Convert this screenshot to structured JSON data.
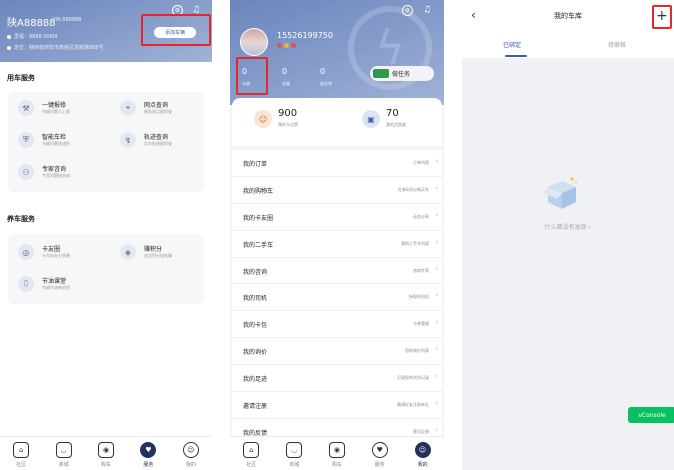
{
  "panel1": {
    "plate": "陕A88888",
    "vin": "VIN:888888",
    "mileage": "里程：8888.00KM",
    "location": "定位：陕西省西安市高新区高新路888号",
    "add_car_label": "添加车辆",
    "section_car": "用车服务",
    "car_services": [
      {
        "icon": "wrench-icon",
        "glyph": "⚒",
        "title": "一键报修",
        "sub": "车辆问题马上报"
      },
      {
        "icon": "location-icon",
        "glyph": "⌖",
        "title": "网点查询",
        "sub": "服务网点随时查"
      },
      {
        "icon": "shield-icon",
        "glyph": "⛨",
        "title": "智能车检",
        "sub": "车辆问题快速检"
      },
      {
        "icon": "speed-icon",
        "glyph": "↯",
        "title": "轨迹查询",
        "sub": "实车轨迹随时查"
      },
      {
        "icon": "expert-icon",
        "glyph": "⚇",
        "title": "专家咨询",
        "sub": "专家问题快咨询"
      }
    ],
    "section_maintain": "养车服务",
    "maintain_services": [
      {
        "icon": "friends-icon",
        "glyph": "◎",
        "title": "卡友圈",
        "sub": "卡车好友分享圈"
      },
      {
        "icon": "points-icon",
        "glyph": "◈",
        "title": "赚积分",
        "sub": "会员积分轻松赚"
      },
      {
        "icon": "drop-icon",
        "glyph": "⬯",
        "title": "节油课堂",
        "sub": "车辆节油有妙招"
      }
    ],
    "tabs": [
      {
        "icon": "home-icon",
        "glyph": "⌂",
        "label": "社区",
        "active": false
      },
      {
        "icon": "mall-icon",
        "glyph": "◡",
        "label": "商城",
        "active": false
      },
      {
        "icon": "car-icon",
        "glyph": "◉",
        "label": "购车",
        "active": false
      },
      {
        "icon": "service-icon",
        "glyph": "♥",
        "label": "服务",
        "active": true
      },
      {
        "icon": "mine-icon",
        "glyph": "☺",
        "label": "我的",
        "active": false
      }
    ]
  },
  "panel2": {
    "phone": "15526199750",
    "stats": [
      {
        "value": "0",
        "label": "车辆"
      },
      {
        "value": "0",
        "label": "收藏"
      },
      {
        "value": "0",
        "label": "服务单"
      }
    ],
    "task_label": "做任务",
    "points_value": "900",
    "points_label": "我的卡达赞",
    "rank_value": "70",
    "rank_label": "我的活跃度",
    "menu": [
      {
        "label": "我的订单",
        "right": "订单列表"
      },
      {
        "label": "我的购物车",
        "right": "礼券&积分购买车"
      },
      {
        "label": "我的卡友圈",
        "right": "动态分享"
      },
      {
        "label": "我的二手车",
        "right": "我的二手车列表"
      },
      {
        "label": "我的咨询",
        "right": "咨询专家"
      },
      {
        "label": "我的司机",
        "right": "授权的司机"
      },
      {
        "label": "我的卡包",
        "right": "卡券管理"
      },
      {
        "label": "我的询价",
        "right": "您的询价列表"
      },
      {
        "label": "我的足迹",
        "right": "记录您的浏览记录"
      },
      {
        "label": "邀请注册",
        "right": "邀请好友注册有礼"
      },
      {
        "label": "我的反馈",
        "right": "意见反馈"
      }
    ],
    "tabs": [
      {
        "icon": "home-icon",
        "glyph": "⌂",
        "label": "社区",
        "active": false
      },
      {
        "icon": "mall-icon",
        "glyph": "◡",
        "label": "商城",
        "active": false
      },
      {
        "icon": "car-icon",
        "glyph": "◉",
        "label": "购车",
        "active": false
      },
      {
        "icon": "service-icon",
        "glyph": "♥",
        "label": "服务",
        "active": false
      },
      {
        "icon": "mine-icon",
        "glyph": "☺",
        "label": "我的",
        "active": true
      }
    ]
  },
  "panel3": {
    "title": "我的车库",
    "tab_bound": "已绑定",
    "tab_pending": "待审核",
    "empty_text": "什么都没有发现~",
    "vconsole": "vConsole"
  },
  "colors": {
    "header": "#7a91c6",
    "accent": "#3b5fa8",
    "highlight": "#e6262c",
    "vconsole": "#07c160"
  }
}
